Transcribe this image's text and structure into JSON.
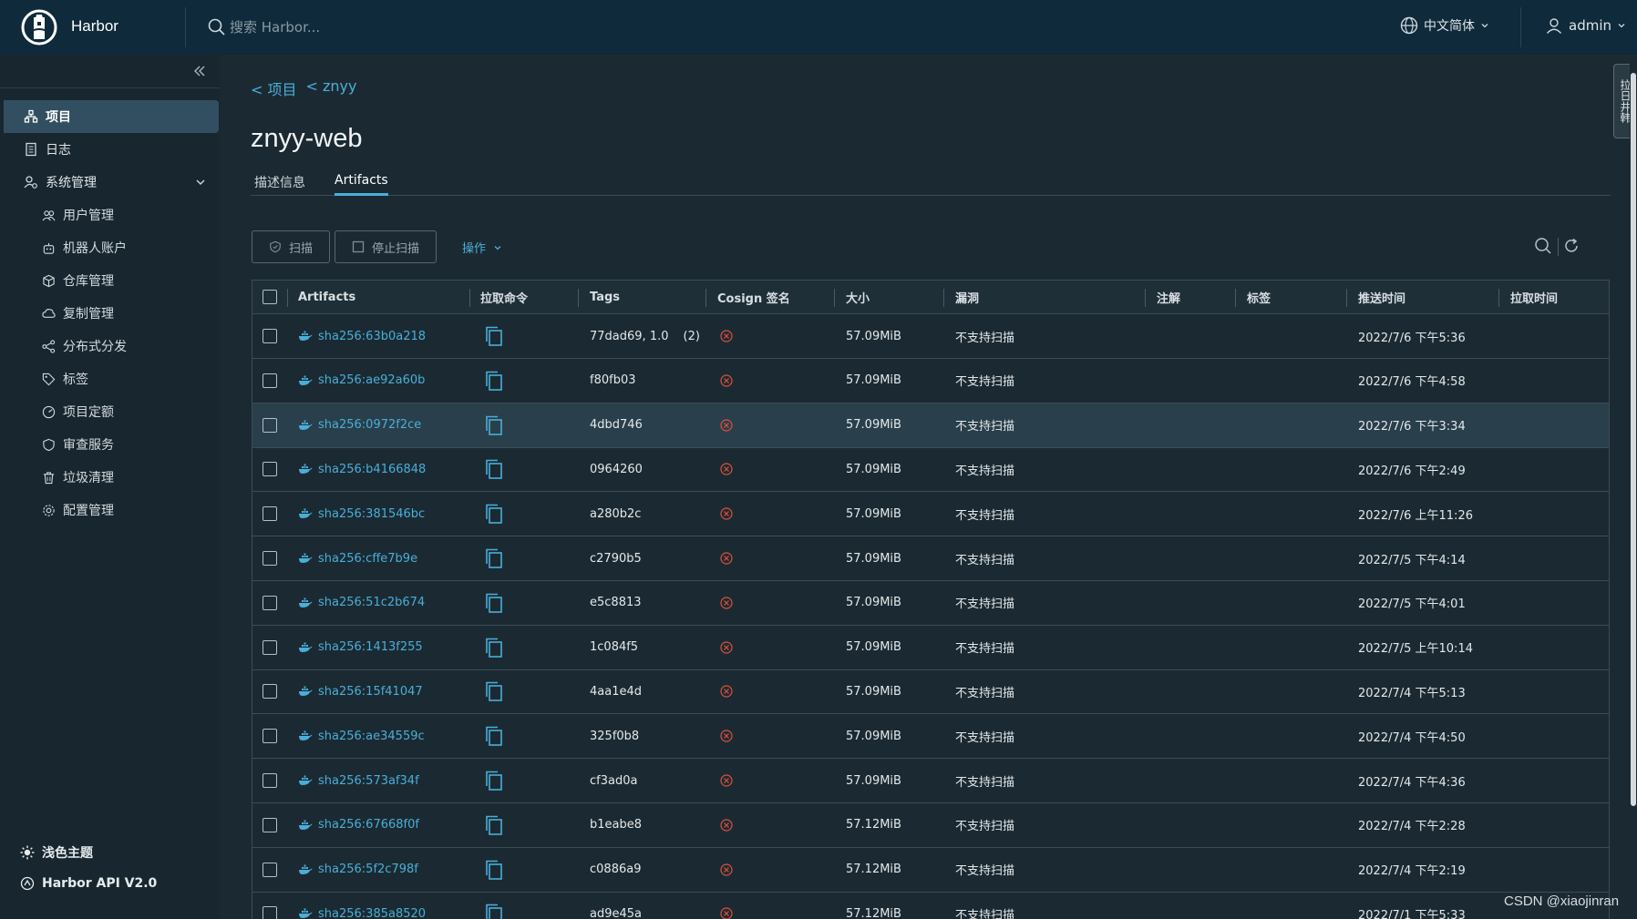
{
  "header": {
    "app_title": "Harbor",
    "search_placeholder": "搜索 Harbor...",
    "language": "中文简体",
    "user": "admin"
  },
  "sidebar": {
    "items": [
      {
        "label": "项目",
        "icon": "project-icon",
        "active": true
      },
      {
        "label": "日志",
        "icon": "log-icon"
      },
      {
        "label": "系统管理",
        "icon": "admin-icon"
      }
    ],
    "sub_items": [
      {
        "label": "用户管理",
        "icon": "users-icon"
      },
      {
        "label": "机器人账户",
        "icon": "robot-icon"
      },
      {
        "label": "仓库管理",
        "icon": "registry-icon"
      },
      {
        "label": "复制管理",
        "icon": "replication-icon"
      },
      {
        "label": "分布式分发",
        "icon": "distribution-icon"
      },
      {
        "label": "标签",
        "icon": "tag-icon"
      },
      {
        "label": "项目定额",
        "icon": "quota-icon"
      },
      {
        "label": "审查服务",
        "icon": "shield-icon"
      },
      {
        "label": "垃圾清理",
        "icon": "trash-icon"
      },
      {
        "label": "配置管理",
        "icon": "gear-icon"
      }
    ],
    "theme": "浅色主题",
    "api": "Harbor API V2.0"
  },
  "breadcrumb": {
    "item1": "< 项目",
    "item2": "< znyy"
  },
  "page_title": "znyy-web",
  "tabs": {
    "info": "描述信息",
    "artifacts": "Artifacts"
  },
  "toolbar": {
    "scan": "扫描",
    "stop_scan": "停止扫描",
    "actions": "操作"
  },
  "table": {
    "headers": {
      "artifacts": "Artifacts",
      "pull_command": "拉取命令",
      "tags": "Tags",
      "cosign": "Cosign 签名",
      "size": "大小",
      "vulnerabilities": "漏洞",
      "annotations": "注解",
      "labels": "标签",
      "push_time": "推送时间",
      "pull_time": "拉取时间"
    },
    "rows": [
      {
        "digest": "sha256:63b0a218",
        "tags": "77dad69, 1.0",
        "tag_count": "(2)",
        "size": "57.09MiB",
        "vuln": "不支持扫描",
        "push_time": "2022/7/6 下午5:36"
      },
      {
        "digest": "sha256:ae92a60b",
        "tags": "f80fb03",
        "tag_count": "",
        "size": "57.09MiB",
        "vuln": "不支持扫描",
        "push_time": "2022/7/6 下午4:58"
      },
      {
        "digest": "sha256:0972f2ce",
        "tags": "4dbd746",
        "tag_count": "",
        "size": "57.09MiB",
        "vuln": "不支持扫描",
        "push_time": "2022/7/6 下午3:34"
      },
      {
        "digest": "sha256:b4166848",
        "tags": "0964260",
        "tag_count": "",
        "size": "57.09MiB",
        "vuln": "不支持扫描",
        "push_time": "2022/7/6 下午2:49"
      },
      {
        "digest": "sha256:381546bc",
        "tags": "a280b2c",
        "tag_count": "",
        "size": "57.09MiB",
        "vuln": "不支持扫描",
        "push_time": "2022/7/6 上午11:26"
      },
      {
        "digest": "sha256:cffe7b9e",
        "tags": "c2790b5",
        "tag_count": "",
        "size": "57.09MiB",
        "vuln": "不支持扫描",
        "push_time": "2022/7/5 下午4:14"
      },
      {
        "digest": "sha256:51c2b674",
        "tags": "e5c8813",
        "tag_count": "",
        "size": "57.09MiB",
        "vuln": "不支持扫描",
        "push_time": "2022/7/5 下午4:01"
      },
      {
        "digest": "sha256:1413f255",
        "tags": "1c084f5",
        "tag_count": "",
        "size": "57.09MiB",
        "vuln": "不支持扫描",
        "push_time": "2022/7/5 上午10:14"
      },
      {
        "digest": "sha256:15f41047",
        "tags": "4aa1e4d",
        "tag_count": "",
        "size": "57.09MiB",
        "vuln": "不支持扫描",
        "push_time": "2022/7/4 下午5:13"
      },
      {
        "digest": "sha256:ae34559c",
        "tags": "325f0b8",
        "tag_count": "",
        "size": "57.09MiB",
        "vuln": "不支持扫描",
        "push_time": "2022/7/4 下午4:50"
      },
      {
        "digest": "sha256:573af34f",
        "tags": "cf3ad0a",
        "tag_count": "",
        "size": "57.09MiB",
        "vuln": "不支持扫描",
        "push_time": "2022/7/4 下午4:36"
      },
      {
        "digest": "sha256:67668f0f",
        "tags": "b1eabe8",
        "tag_count": "",
        "size": "57.12MiB",
        "vuln": "不支持扫描",
        "push_time": "2022/7/4 下午2:28"
      },
      {
        "digest": "sha256:5f2c798f",
        "tags": "c0886a9",
        "tag_count": "",
        "size": "57.12MiB",
        "vuln": "不支持扫描",
        "push_time": "2022/7/4 下午2:19"
      },
      {
        "digest": "sha256:385a8520",
        "tags": "ad9e45a",
        "tag_count": "",
        "size": "57.12MiB",
        "vuln": "不支持扫描",
        "push_time": "2022/7/1 下午5:33"
      }
    ]
  },
  "right_tab": "拉日井韩",
  "watermark": "CSDN @xiaojinran",
  "colors": {
    "accent": "#4aaed9",
    "header_bg": "#0e2a3b",
    "sidebar_bg": "#18272f",
    "page_bg": "#1b2a32",
    "error": "#c92100"
  }
}
